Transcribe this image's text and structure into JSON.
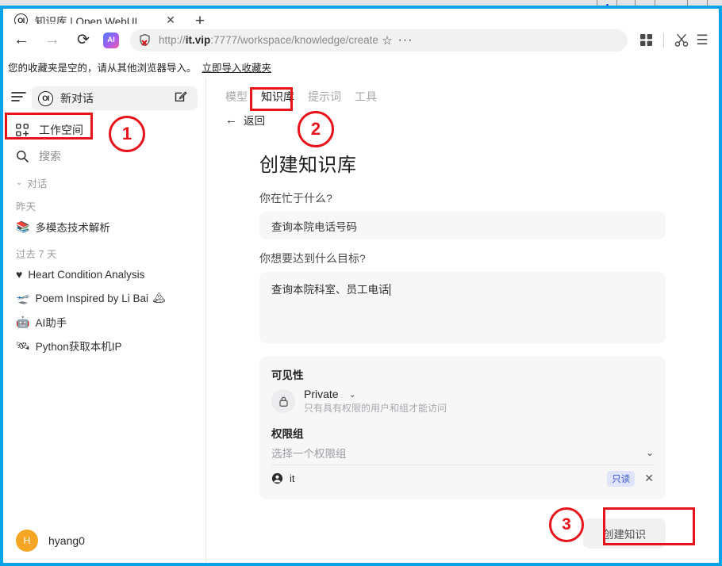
{
  "window": {
    "controls": [
      "minimize",
      "restore",
      "close"
    ]
  },
  "browser": {
    "tab": {
      "favicon_text": "OI",
      "title": "知识库 | Open WebUI",
      "close_label": "✕"
    },
    "new_tab_label": "+",
    "nav": {
      "back": "←",
      "forward": "→",
      "reload": "⟳",
      "ai_badge": "AI"
    },
    "omnibox": {
      "url_scheme": "http://",
      "url_host": "it.vip",
      "url_rest": ":7777/workspace/knowledge/create",
      "security_icon": "shield-blocked-icon",
      "star": "☆",
      "more": "···"
    },
    "toolbar": {
      "apps_icon": "grid-apps-icon",
      "capture_icon": "scissors-icon",
      "menu_icon": "hamburger-menu-icon",
      "menu_label": "☰"
    },
    "bookmarks_bar": {
      "message": "您的收藏夹是空的，请从其他浏览器导入。",
      "import_link": "立即导入收藏夹"
    }
  },
  "sidebar": {
    "hamburger_icon": "menu-lines-icon",
    "new_chat": {
      "badge": "OI",
      "label": "新对话",
      "edit_icon": "pencil-square-icon"
    },
    "nav_items": [
      {
        "label": "工作空间",
        "icon": "workspace-grid-icon"
      },
      {
        "label": "搜索",
        "icon": "search-icon"
      }
    ],
    "chats_section": {
      "label": "对话",
      "chevron": "⌄"
    },
    "groups": [
      {
        "label": "昨天",
        "items": [
          {
            "emoji": "📚",
            "title": "多模态技术解析",
            "emoji2": ""
          }
        ]
      },
      {
        "label": "过去 7 天",
        "items": [
          {
            "emoji": "♥",
            "title": "Heart Condition Analysis",
            "emoji2": ""
          },
          {
            "emoji": "🛫",
            "title": "Poem Inspired by Li Bai",
            "emoji2": "🏔"
          },
          {
            "emoji": "🤖",
            "title": "AI助手",
            "emoji2": ""
          },
          {
            "emoji": "🛰",
            "title": "Python获取本机IP",
            "emoji2": ""
          }
        ]
      }
    ],
    "user": {
      "initial": "H",
      "name": "hyang0",
      "avatar_color": "#f5a524"
    }
  },
  "main": {
    "tabs": [
      {
        "label": "模型",
        "active": false
      },
      {
        "label": "知识库",
        "active": true
      },
      {
        "label": "提示词",
        "active": false
      },
      {
        "label": "工具",
        "active": false
      }
    ],
    "back": {
      "arrow": "←",
      "label": "返回"
    },
    "form": {
      "title": "创建知识库",
      "name_label": "你在忙于什么?",
      "name_value": "查询本院电话号码",
      "goal_label": "你想要达到什么目标?",
      "goal_value": "查询本院科室、员工电话",
      "visibility": {
        "section_label": "可见性",
        "icon": "lock-icon",
        "value": "Private",
        "chevron": "⌄",
        "description": "只有具有权限的用户和组才能访问"
      },
      "access_groups": {
        "section_label": "权限组",
        "select_placeholder": "选择一个权限组",
        "chevron": "⌄",
        "members": [
          {
            "icon": "user-circle-icon",
            "name": "it",
            "permission_badge": "只读",
            "remove_label": "✕"
          }
        ]
      },
      "submit_label": "创建知识"
    }
  },
  "annotations": {
    "color": "#e8141c",
    "steps": [
      {
        "number": "1",
        "target": "工作空间"
      },
      {
        "number": "2",
        "target": "知识库"
      },
      {
        "number": "3",
        "target": "创建知识"
      }
    ]
  }
}
